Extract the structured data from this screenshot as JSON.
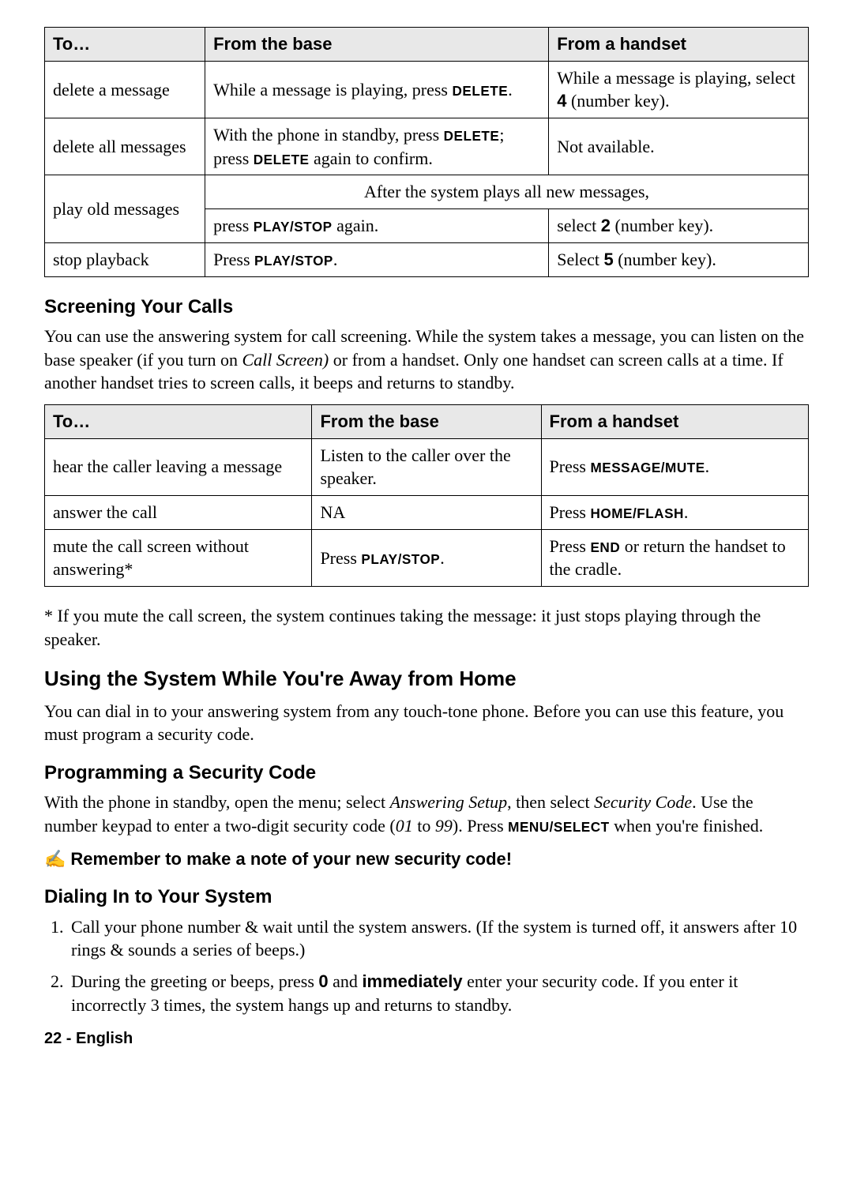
{
  "table1": {
    "headers": {
      "to": "To…",
      "base": "From the base",
      "handset": "From a handset"
    },
    "rows": {
      "delete_msg": {
        "to": "delete a message",
        "base_pre": "While a message is playing, press ",
        "base_key": "DELETE",
        "base_post": ".",
        "handset_pre": "While a message is playing, select ",
        "handset_key": "4",
        "handset_post": " (number key)."
      },
      "delete_all": {
        "to": "delete all messages",
        "base_pre": "With the phone in standby, press ",
        "base_key1": "DELETE",
        "base_mid": "; press ",
        "base_key2": "DELETE",
        "base_post": " again to confirm.",
        "handset": "Not available."
      },
      "play_old": {
        "to": "play old messages",
        "span_text": "After the system plays all new messages,",
        "base_pre": "press ",
        "base_key": "PLAY/STOP",
        "base_post": " again.",
        "handset_pre": "select ",
        "handset_key": "2",
        "handset_post": " (number key)."
      },
      "stop": {
        "to": "stop playback",
        "base_pre": "Press ",
        "base_key": "PLAY/STOP",
        "base_post": ".",
        "handset_pre": "Select ",
        "handset_key": "5",
        "handset_post": " (number key)."
      }
    }
  },
  "section_screening": {
    "heading": "Screening Your Calls",
    "para_pre": "You can use the answering system for call screening. While the system takes a message, you can listen on the base speaker (if you turn on ",
    "para_italic": "Call Screen)",
    "para_post": " or from a handset. Only one handset can screen calls at a time. If another handset tries to screen calls, it beeps and returns to standby."
  },
  "table2": {
    "headers": {
      "to": "To…",
      "base": "From the base",
      "handset": "From a handset"
    },
    "rows": {
      "hear": {
        "to": "hear the caller leaving a message",
        "base": "Listen to the caller over the speaker.",
        "handset_pre": "Press ",
        "handset_key": "MESSAGE/MUTE",
        "handset_post": "."
      },
      "answer": {
        "to": "answer the call",
        "base": "NA",
        "handset_pre": "Press ",
        "handset_key": "HOME/FLASH",
        "handset_post": "."
      },
      "mute": {
        "to": "mute the call screen without answering*",
        "base_pre": "Press ",
        "base_key": "PLAY/STOP",
        "base_post": ".",
        "handset_pre": "Press ",
        "handset_key": "END",
        "handset_post": " or return the handset to the cradle."
      }
    }
  },
  "footnote": "*  If you mute the call screen, the system continues taking the message: it just stops playing through the speaker.",
  "section_away": {
    "heading": "Using the System While You're Away from Home",
    "para": "You can dial in to your answering system from any touch-tone phone. Before you can use this feature, you must program a security code."
  },
  "section_security": {
    "heading": "Programming a Security Code",
    "pre1": "With the phone in standby, open the menu; select ",
    "it1": "Answering Setup",
    "mid1": ", then select ",
    "it2": "Security Code",
    "mid2": ". Use the number keypad to enter a two-digit security code (",
    "it3": "01",
    "mid3": " to ",
    "it4": "99",
    "mid4": "). Press ",
    "key": "MENU/SELECT",
    "post": " when you're finished.",
    "note_icon": "✍",
    "note_text": "Remember to make a note of your new security code!"
  },
  "section_dial": {
    "heading": "Dialing In to Your System",
    "step1": "Call your phone number & wait until the system answers. (If the system is turned off, it answers after 10 rings & sounds a series of beeps.)",
    "step2_pre": "During the greeting or beeps, press ",
    "step2_key": "0",
    "step2_mid": " and ",
    "step2_bold": "immediately",
    "step2_post": " enter your security code. If you enter it incorrectly 3 times, the system hangs up and returns to standby."
  },
  "footer": "22 - English"
}
